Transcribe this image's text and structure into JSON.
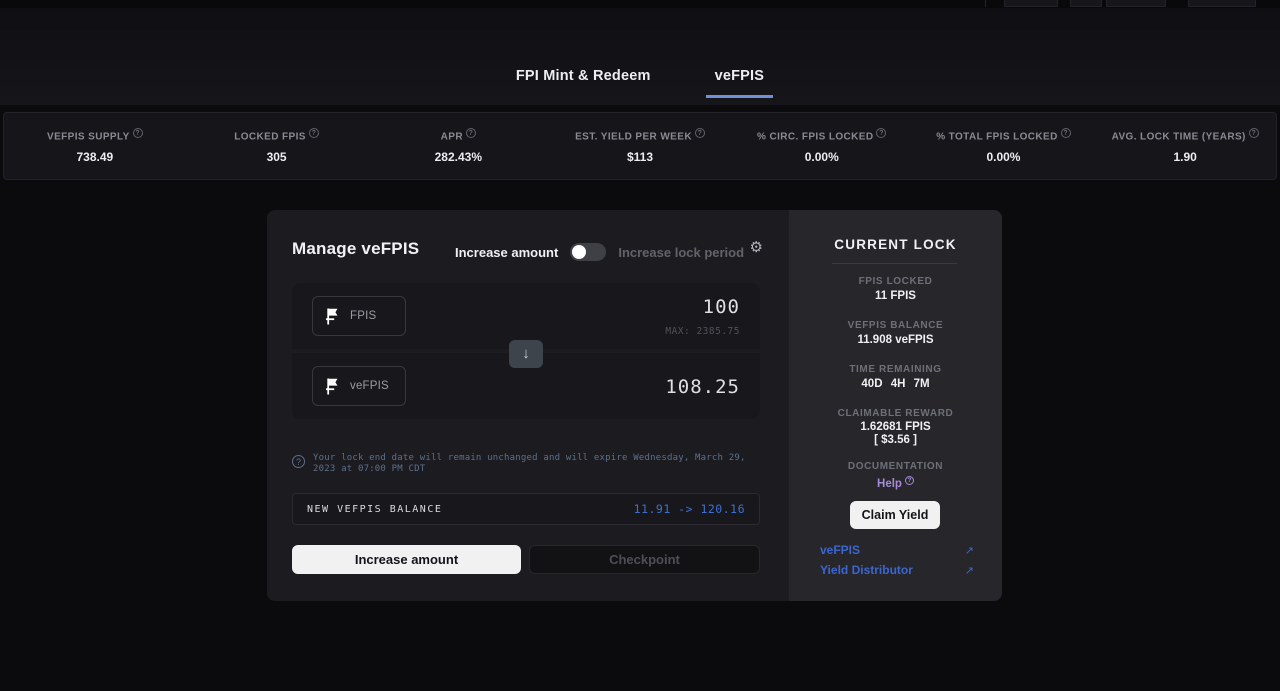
{
  "tabs": [
    {
      "label": "FPI Mint & Redeem",
      "active": false
    },
    {
      "label": "veFPIS",
      "active": true
    }
  ],
  "stats": [
    {
      "label": "VEFPIS SUPPLY",
      "value": "738.49"
    },
    {
      "label": "LOCKED FPIS",
      "value": "305"
    },
    {
      "label": "APR",
      "value": "282.43%"
    },
    {
      "label": "EST. YIELD PER WEEK",
      "value": "$113"
    },
    {
      "label": "% CIRC. FPIS LOCKED",
      "value": "0.00%"
    },
    {
      "label": "% TOTAL FPIS LOCKED",
      "value": "0.00%"
    },
    {
      "label": "AVG. LOCK TIME (YEARS)",
      "value": "1.90"
    }
  ],
  "manage": {
    "title": "Manage veFPIS",
    "toggle_left": "Increase amount",
    "toggle_right": "Increase lock period",
    "from_token": "FPIS",
    "from_amount": "100",
    "from_max": "MAX: 2385.75",
    "to_token": "veFPIS",
    "to_amount": "108.25",
    "note": "Your lock end date will remain unchanged and will expire Wednesday, March 29, 2023 at 07:00 PM CDT",
    "balance_label": "NEW VEFPIS BALANCE",
    "balance_value": "11.91 -> 120.16",
    "primary_button": "Increase amount",
    "secondary_button": "Checkpoint"
  },
  "current_lock": {
    "title": "CURRENT LOCK",
    "fpis_locked_label": "FPIS LOCKED",
    "fpis_locked_value": "11 FPIS",
    "vefpis_balance_label": "VEFPIS BALANCE",
    "vefpis_balance_value": "11.908 veFPIS",
    "time_remaining_label": "TIME REMAINING",
    "time_remaining_value": "40D 4H 7M",
    "claimable_label": "CLAIMABLE REWARD",
    "claimable_value": "1.62681 FPIS",
    "claimable_usd": "[ $3.56 ]",
    "documentation_label": "DOCUMENTATION",
    "help_link": "Help",
    "claim_button": "Claim Yield",
    "links": [
      {
        "label": "veFPIS"
      },
      {
        "label": "Yield Distributor"
      }
    ]
  },
  "icons": {
    "question": "?",
    "gear": "⚙",
    "down_arrow": "↓",
    "external_link": "↗"
  },
  "colors": {
    "accent_blue": "#3f6fd1",
    "link_blue": "#3c66cf",
    "tab_underline": "#6e90d9",
    "help_purple": "#a78bda",
    "note_blue_gray": "#5d6f8d",
    "primary_button_bg": "#f1f1f2"
  }
}
